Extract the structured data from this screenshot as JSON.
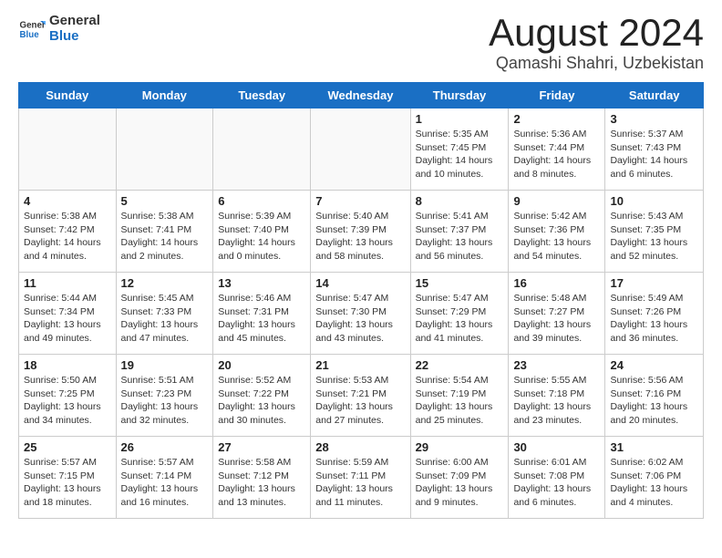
{
  "header": {
    "logo_line1": "General",
    "logo_line2": "Blue",
    "month_title": "August 2024",
    "location": "Qamashi Shahri, Uzbekistan"
  },
  "days_of_week": [
    "Sunday",
    "Monday",
    "Tuesday",
    "Wednesday",
    "Thursday",
    "Friday",
    "Saturday"
  ],
  "weeks": [
    [
      {
        "day": "",
        "info": ""
      },
      {
        "day": "",
        "info": ""
      },
      {
        "day": "",
        "info": ""
      },
      {
        "day": "",
        "info": ""
      },
      {
        "day": "1",
        "info": "Sunrise: 5:35 AM\nSunset: 7:45 PM\nDaylight: 14 hours\nand 10 minutes."
      },
      {
        "day": "2",
        "info": "Sunrise: 5:36 AM\nSunset: 7:44 PM\nDaylight: 14 hours\nand 8 minutes."
      },
      {
        "day": "3",
        "info": "Sunrise: 5:37 AM\nSunset: 7:43 PM\nDaylight: 14 hours\nand 6 minutes."
      }
    ],
    [
      {
        "day": "4",
        "info": "Sunrise: 5:38 AM\nSunset: 7:42 PM\nDaylight: 14 hours\nand 4 minutes."
      },
      {
        "day": "5",
        "info": "Sunrise: 5:38 AM\nSunset: 7:41 PM\nDaylight: 14 hours\nand 2 minutes."
      },
      {
        "day": "6",
        "info": "Sunrise: 5:39 AM\nSunset: 7:40 PM\nDaylight: 14 hours\nand 0 minutes."
      },
      {
        "day": "7",
        "info": "Sunrise: 5:40 AM\nSunset: 7:39 PM\nDaylight: 13 hours\nand 58 minutes."
      },
      {
        "day": "8",
        "info": "Sunrise: 5:41 AM\nSunset: 7:37 PM\nDaylight: 13 hours\nand 56 minutes."
      },
      {
        "day": "9",
        "info": "Sunrise: 5:42 AM\nSunset: 7:36 PM\nDaylight: 13 hours\nand 54 minutes."
      },
      {
        "day": "10",
        "info": "Sunrise: 5:43 AM\nSunset: 7:35 PM\nDaylight: 13 hours\nand 52 minutes."
      }
    ],
    [
      {
        "day": "11",
        "info": "Sunrise: 5:44 AM\nSunset: 7:34 PM\nDaylight: 13 hours\nand 49 minutes."
      },
      {
        "day": "12",
        "info": "Sunrise: 5:45 AM\nSunset: 7:33 PM\nDaylight: 13 hours\nand 47 minutes."
      },
      {
        "day": "13",
        "info": "Sunrise: 5:46 AM\nSunset: 7:31 PM\nDaylight: 13 hours\nand 45 minutes."
      },
      {
        "day": "14",
        "info": "Sunrise: 5:47 AM\nSunset: 7:30 PM\nDaylight: 13 hours\nand 43 minutes."
      },
      {
        "day": "15",
        "info": "Sunrise: 5:47 AM\nSunset: 7:29 PM\nDaylight: 13 hours\nand 41 minutes."
      },
      {
        "day": "16",
        "info": "Sunrise: 5:48 AM\nSunset: 7:27 PM\nDaylight: 13 hours\nand 39 minutes."
      },
      {
        "day": "17",
        "info": "Sunrise: 5:49 AM\nSunset: 7:26 PM\nDaylight: 13 hours\nand 36 minutes."
      }
    ],
    [
      {
        "day": "18",
        "info": "Sunrise: 5:50 AM\nSunset: 7:25 PM\nDaylight: 13 hours\nand 34 minutes."
      },
      {
        "day": "19",
        "info": "Sunrise: 5:51 AM\nSunset: 7:23 PM\nDaylight: 13 hours\nand 32 minutes."
      },
      {
        "day": "20",
        "info": "Sunrise: 5:52 AM\nSunset: 7:22 PM\nDaylight: 13 hours\nand 30 minutes."
      },
      {
        "day": "21",
        "info": "Sunrise: 5:53 AM\nSunset: 7:21 PM\nDaylight: 13 hours\nand 27 minutes."
      },
      {
        "day": "22",
        "info": "Sunrise: 5:54 AM\nSunset: 7:19 PM\nDaylight: 13 hours\nand 25 minutes."
      },
      {
        "day": "23",
        "info": "Sunrise: 5:55 AM\nSunset: 7:18 PM\nDaylight: 13 hours\nand 23 minutes."
      },
      {
        "day": "24",
        "info": "Sunrise: 5:56 AM\nSunset: 7:16 PM\nDaylight: 13 hours\nand 20 minutes."
      }
    ],
    [
      {
        "day": "25",
        "info": "Sunrise: 5:57 AM\nSunset: 7:15 PM\nDaylight: 13 hours\nand 18 minutes."
      },
      {
        "day": "26",
        "info": "Sunrise: 5:57 AM\nSunset: 7:14 PM\nDaylight: 13 hours\nand 16 minutes."
      },
      {
        "day": "27",
        "info": "Sunrise: 5:58 AM\nSunset: 7:12 PM\nDaylight: 13 hours\nand 13 minutes."
      },
      {
        "day": "28",
        "info": "Sunrise: 5:59 AM\nSunset: 7:11 PM\nDaylight: 13 hours\nand 11 minutes."
      },
      {
        "day": "29",
        "info": "Sunrise: 6:00 AM\nSunset: 7:09 PM\nDaylight: 13 hours\nand 9 minutes."
      },
      {
        "day": "30",
        "info": "Sunrise: 6:01 AM\nSunset: 7:08 PM\nDaylight: 13 hours\nand 6 minutes."
      },
      {
        "day": "31",
        "info": "Sunrise: 6:02 AM\nSunset: 7:06 PM\nDaylight: 13 hours\nand 4 minutes."
      }
    ]
  ]
}
